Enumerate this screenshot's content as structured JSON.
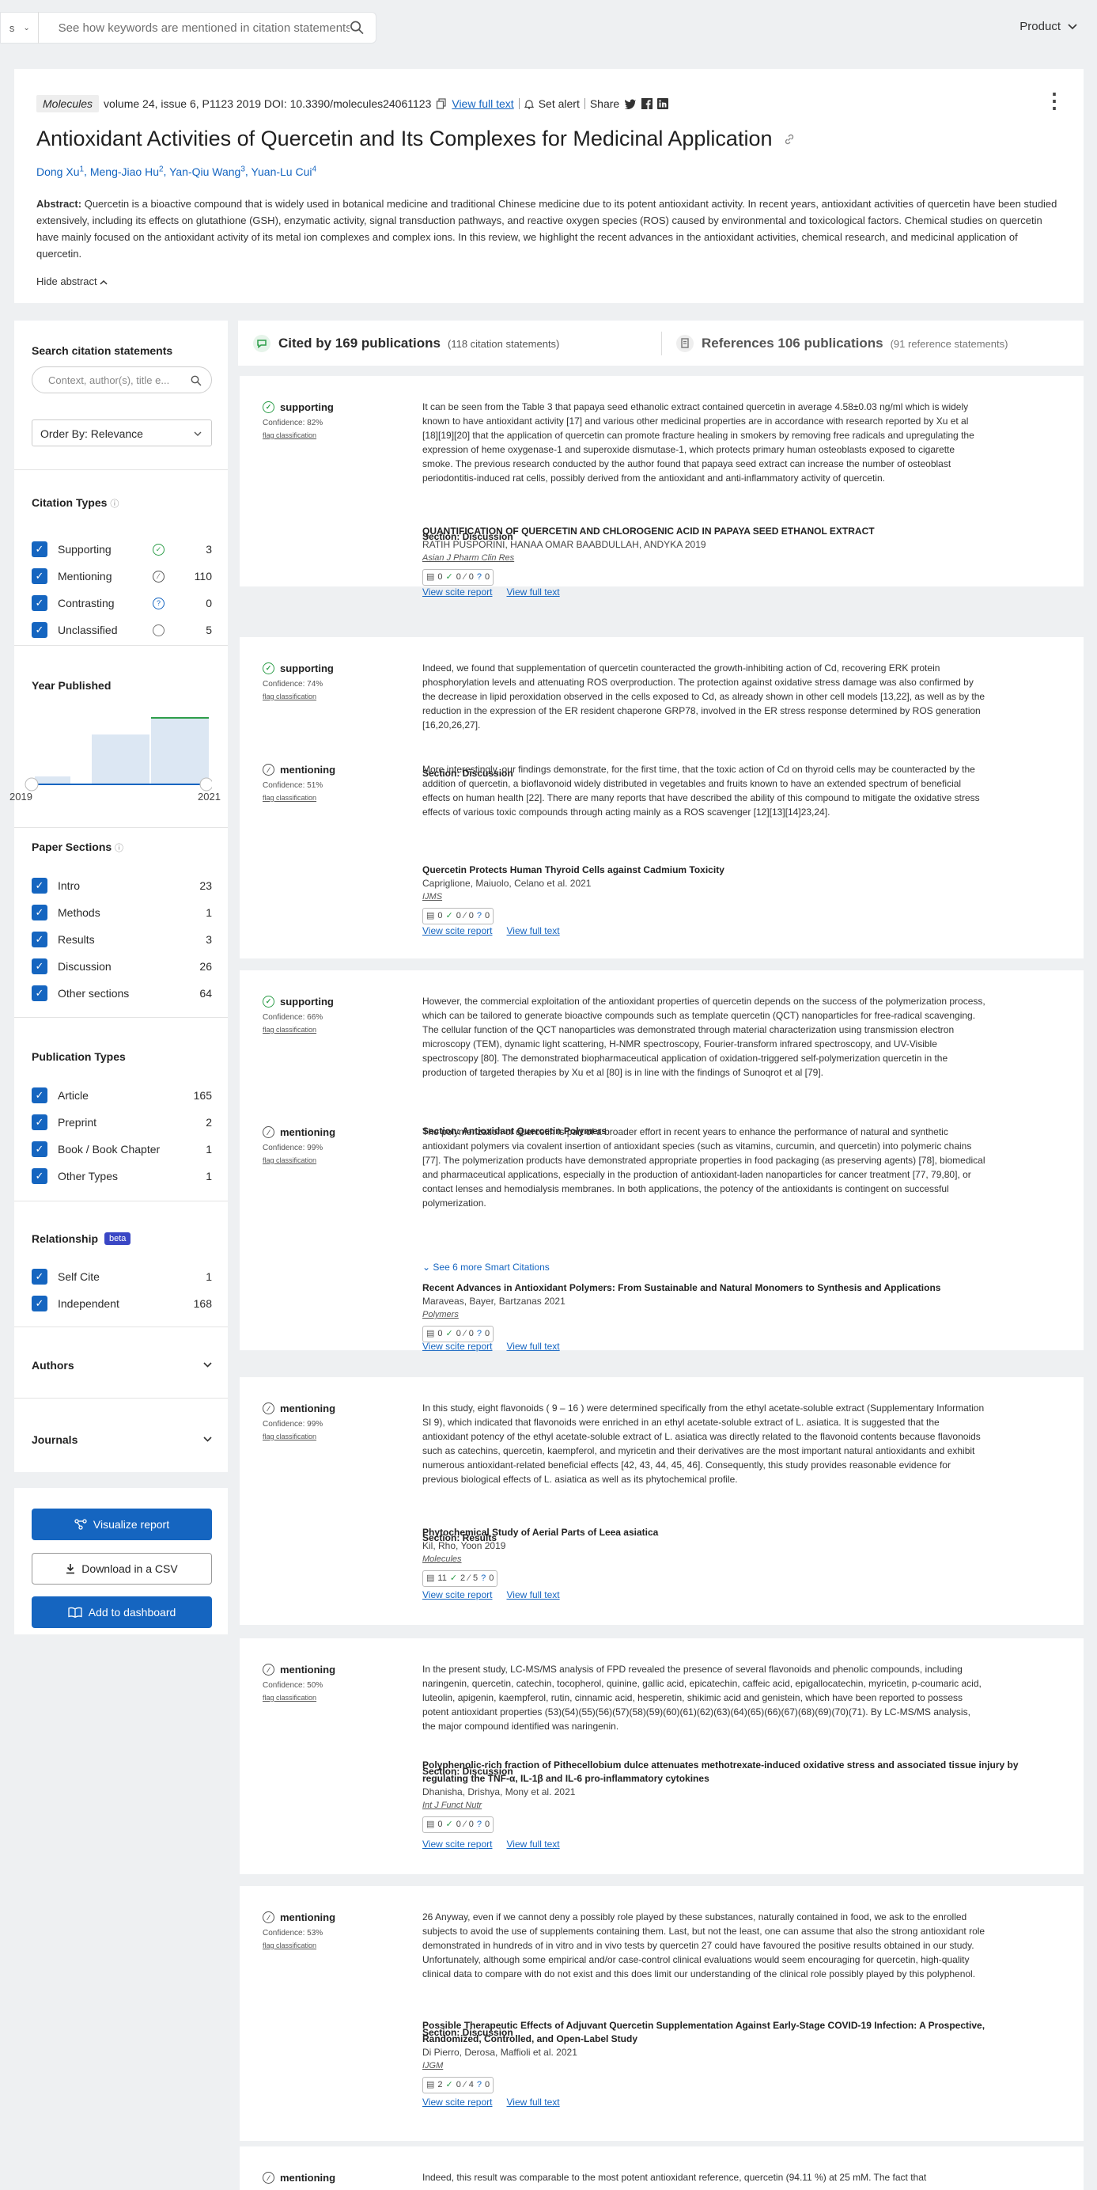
{
  "topbar": {
    "search_prefix": "s",
    "search_placeholder": "See how keywords are mentioned in citation statements",
    "product_label": "Product"
  },
  "paper": {
    "journal": "Molecules",
    "meta_text": "volume 24, issue 6, P1123 2019 DOI: 10.3390/molecules24061123",
    "view_full_text": "View full text",
    "set_alert": "Set alert",
    "share": "Share",
    "title": "Antioxidant Activities of Quercetin and Its Complexes for Medicinal Application",
    "authors": [
      {
        "name": "Dong Xu",
        "sup": "1"
      },
      {
        "name": "Meng-Jiao Hu",
        "sup": "2"
      },
      {
        "name": "Yan-Qiu Wang",
        "sup": "3"
      },
      {
        "name": "Yuan-Lu Cui",
        "sup": "4"
      }
    ],
    "abstract_label": "Abstract:",
    "abstract": "Quercetin is a bioactive compound that is widely used in botanical medicine and traditional Chinese medicine due to its potent antioxidant activity. In recent years, antioxidant activities of quercetin have been studied extensively, including its effects on glutathione (GSH), enzymatic activity, signal transduction pathways, and reactive oxygen species (ROS) caused by environmental and toxicological factors. Chemical studies on quercetin have mainly focused on the antioxidant activity of its metal ion complexes and complex ions. In this review, we highlight the recent advances in the antioxidant activities, chemical research, and medicinal application of quercetin.",
    "hide_abstract": "Hide abstract"
  },
  "sidebar": {
    "search_heading": "Search citation statements",
    "search_placeholder": "Context, author(s), title e...",
    "order_by": "Order By: Relevance",
    "citation_types_heading": "Citation Types",
    "citation_types": [
      {
        "label": "Supporting",
        "count": "3",
        "icon": "check",
        "color": "#2e9e4a"
      },
      {
        "label": "Mentioning",
        "count": "110",
        "icon": "slash",
        "color": "#555555"
      },
      {
        "label": "Contrasting",
        "count": "0",
        "icon": "?",
        "color": "#1565c0"
      },
      {
        "label": "Unclassified",
        "count": "5",
        "icon": "",
        "color": "#777777"
      }
    ],
    "year_heading": "Year Published",
    "year_start": "2019",
    "year_end": "2021",
    "sections_heading": "Paper Sections",
    "sections": [
      {
        "label": "Intro",
        "count": "23"
      },
      {
        "label": "Methods",
        "count": "1"
      },
      {
        "label": "Results",
        "count": "3"
      },
      {
        "label": "Discussion",
        "count": "26"
      },
      {
        "label": "Other sections",
        "count": "64"
      }
    ],
    "pubtypes_heading": "Publication Types",
    "pubtypes": [
      {
        "label": "Article",
        "count": "165"
      },
      {
        "label": "Preprint",
        "count": "2"
      },
      {
        "label": "Book / Book Chapter",
        "count": "1"
      },
      {
        "label": "Other Types",
        "count": "1"
      }
    ],
    "relationship_heading": "Relationship",
    "beta": "beta",
    "relationship": [
      {
        "label": "Self Cite",
        "count": "1"
      },
      {
        "label": "Independent",
        "count": "168"
      }
    ],
    "authors_heading": "Authors",
    "journals_heading": "Journals",
    "visualize": "Visualize report",
    "download": "Download in a CSV",
    "dashboard": "Add to dashboard"
  },
  "tabs": {
    "cited_bold": "Cited by 169 publications",
    "cited_sub": "(118 citation statements)",
    "refs_bold": "References 106 publications",
    "refs_sub": "(91 reference statements)"
  },
  "common": {
    "flag": "flag classification",
    "view_scite": "View scite report",
    "view_full": "View full text"
  },
  "cards": [
    {
      "cits": [
        {
          "type": "supporting",
          "conf": "Confidence: 82%",
          "text": "It can be seen from the Table 3 that papaya seed ethanolic extract contained quercetin in average 4.58±0.03 ng/ml which is widely known to have antioxidant activity [17] and various other medicinal properties are in accordance with research reported by Xu et al [18][19][20] that the application of quercetin can promote fracture healing in smokers by removing free radicals and upregulating the expression of heme oxygenase-1 and superoxide dismutase-1, which protects primary human osteoblasts exposed to cigarette smoke. The previous research conducted by the author found that papaya seed extract can increase the number of osteoblast periodontitis-induced rat cells, possibly derived from the antioxidant and anti-inflammatory activity of quercetin.",
          "section": "Section: Discussion"
        }
      ],
      "paper_title": "QUANTIFICATION OF QUERCETIN AND CHLOROGENIC ACID IN PAPAYA SEED ETHANOL EXTRACT",
      "paper_authors": "RATIH PUSPORINI, HANAA OMAR BAABDULLAH, ANDYKA 2019",
      "paper_journal": "Asian J Pharm Clin Res",
      "tally": [
        "0",
        "0",
        "0",
        "0"
      ]
    },
    {
      "cits": [
        {
          "type": "supporting",
          "conf": "Confidence: 74%",
          "text": "Indeed, we found that supplementation of quercetin counteracted the growth-inhibiting action of Cd, recovering ERK protein phosphorylation levels and attenuating ROS overproduction. The protection against oxidative stress damage was also confirmed by the decrease in lipid peroxidation observed in the cells exposed to Cd, as already shown in other cell models [13,22], as well as by the reduction in the expression of the ER resident chaperone GRP78, involved in the ER stress response determined by ROS generation [16,20,26,27].",
          "section": "Section: Discussion"
        },
        {
          "type": "mentioning",
          "conf": "Confidence: 51%",
          "text": "More interestingly, our findings demonstrate, for the first time, that the toxic action of Cd on thyroid cells may be counteracted by the addition of quercetin, a bioflavonoid widely distributed in vegetables and fruits known to have an extended spectrum of beneficial effects on human health [22]. There are many reports that have described the ability of this compound to mitigate the oxidative stress effects of various toxic compounds through acting mainly as a ROS scavenger [12][13][14]23,24].",
          "section": "Section: Discussion"
        }
      ],
      "paper_title": "Quercetin Protects Human Thyroid Cells against Cadmium Toxicity",
      "paper_authors": "Capriglione, Maiuolo, Celano et al. 2021",
      "paper_journal": "IJMS",
      "tally": [
        "0",
        "0",
        "0",
        "0"
      ]
    },
    {
      "cits": [
        {
          "type": "supporting",
          "conf": "Confidence: 66%",
          "text": "However, the commercial exploitation of the antioxidant properties of quercetin depends on the success of the polymerization process, which can be tailored to generate bioactive compounds such as template quercetin (QCT) nanoparticles for free-radical scavenging. The cellular function of the QCT nanoparticles was demonstrated through material characterization using transmission electron microscopy (TEM), dynamic light scattering, H-NMR spectroscopy, Fourier-transform infrared spectroscopy, and UV-Visible spectroscopy [80]. The demonstrated biopharmaceutical application of oxidation-triggered self-polymerization quercetin in the production of targeted therapies by Xu et al [80] is in line with the findings of Sunoqrot et al [79].",
          "section": "Section: Antioxidant Quercetin Polymers"
        },
        {
          "type": "mentioning",
          "conf": "Confidence: 99%",
          "text": "The polymerization of quercetin is part of a broader effort in recent years to enhance the performance of natural and synthetic antioxidant polymers via covalent insertion of antioxidant species (such as vitamins, curcumin, and quercetin) into polymeric chains [77]. The polymerization products have demonstrated appropriate properties in food packaging (as preserving agents) [78], biomedical and pharmaceutical applications, especially in the production of antioxidant-laden nanoparticles for cancer treatment [77, 79,80], or contact lenses and hemodialysis membranes. In both applications, the potency of the antioxidants is contingent on successful polymerization.",
          "section": "Section: Antioxidant Quercetin Polymers"
        }
      ],
      "see_more": "See 6 more Smart Citations",
      "paper_title": "Recent Advances in Antioxidant Polymers: From Sustainable and Natural Monomers to Synthesis and Applications",
      "paper_authors": "Maraveas, Bayer, Bartzanas 2021",
      "paper_journal": "Polymers",
      "tally": [
        "0",
        "0",
        "0",
        "0"
      ]
    },
    {
      "cits": [
        {
          "type": "mentioning",
          "conf": "Confidence: 99%",
          "text": "In this study, eight flavonoids ( 9 – 16 ) were determined specifically from the ethyl acetate-soluble extract (Supplementary Information SI 9), which indicated that flavonoids were enriched in an ethyl acetate-soluble extract of L. asiatica. It is suggested that the antioxidant potency of the ethyl acetate-soluble extract of L. asiatica was directly related to the flavonoid contents because flavonoids such as catechins, quercetin, kaempferol, and myricetin and their derivatives are the most important natural antioxidants and exhibit numerous antioxidant-related beneficial effects [42, 43, 44, 45, 46]. Consequently, this study provides reasonable evidence for previous biological effects of L. asiatica as well as its phytochemical profile.",
          "section": "Section: Results"
        }
      ],
      "paper_title": "Phytochemical Study of Aerial Parts of Leea asiatica",
      "paper_authors": "Kil, Rho, Yoon 2019",
      "paper_journal": "Molecules",
      "tally": [
        "11",
        "2",
        "5",
        "0"
      ]
    },
    {
      "cits": [
        {
          "type": "mentioning",
          "conf": "Confidence: 50%",
          "text": "In the present study, LC-MS/MS analysis of FPD revealed the presence of several flavonoids and phenolic compounds, including naringenin, quercetin, catechin, tocopherol, quinine, gallic acid, epicatechin, caffeic acid, epigallocatechin, myricetin, p-coumaric acid, luteolin, apigenin, kaempferol, rutin, cinnamic acid, hesperetin, shikimic acid and genistein, which have been reported to possess potent antioxidant properties (53)(54)(55)(56)(57)(58)(59)(60)(61)(62)(63)(64)(65)(66)(67)(68)(69)(70)(71). By LC-MS/MS analysis, the major compound identified was naringenin.",
          "section": "Section: Discussion"
        }
      ],
      "paper_title": "Polyphenolic-rich fraction of Pithecellobium dulce attenuates methotrexate-induced oxidative stress and associated tissue injury by regulating the TNF-α, IL-1β and IL-6 pro-inflammatory cytokines",
      "paper_authors": "Dhanisha, Drishya, Mony et al. 2021",
      "paper_journal": "Int J Funct Nutr",
      "tally": [
        "0",
        "0",
        "0",
        "0"
      ]
    },
    {
      "cits": [
        {
          "type": "mentioning",
          "conf": "Confidence: 53%",
          "text": "26 Anyway, even if we cannot deny a possibly role played by these substances, naturally contained in food, we ask to the enrolled subjects to avoid the use of supplements containing them. Last, but not the least, one can assume that also the strong antioxidant role demonstrated in hundreds of in vitro and in vivo tests by quercetin 27 could have favoured the positive results obtained in our study. Unfortunately, although some empirical and/or case-control clinical evaluations would seem encouraging for quercetin, high-quality clinical data to compare with do not exist and this does limit our understanding of the clinical role possibly played by this polyphenol.",
          "section": "Section: Discussion"
        }
      ],
      "paper_title": "Possible Therapeutic Effects of Adjuvant Quercetin Supplementation Against Early-Stage COVID-19 Infection: A Prospective, Randomized, Controlled, and Open-Label Study",
      "paper_authors": "Di Pierro, Derosa, Maffioli et al. 2021",
      "paper_journal": "IJGM",
      "tally": [
        "2",
        "0",
        "4",
        "0"
      ]
    },
    {
      "cits": [
        {
          "type": "mentioning",
          "conf": "",
          "text": "Indeed, this result was comparable to the most potent antioxidant reference, quercetin (94.11 %) at 25 mM. The fact that",
          "section": ""
        }
      ],
      "paper_title": "",
      "paper_authors": "",
      "paper_journal": "",
      "tally": []
    }
  ]
}
